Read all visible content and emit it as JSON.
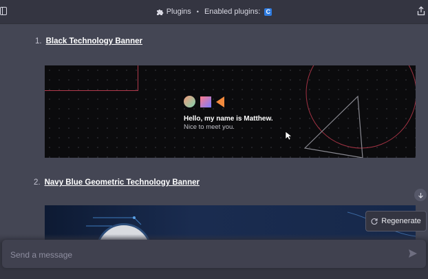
{
  "header": {
    "title": "Plugins",
    "separator": "•",
    "enabled_label": "Enabled plugins:",
    "plugin_badge": "C",
    "accent": "#2e7be0"
  },
  "items": [
    {
      "number": "1.",
      "title": "Black Technology Banner"
    },
    {
      "number": "2.",
      "title": "Navy Blue Geometric Technology Banner"
    }
  ],
  "banner1": {
    "hello": "Hello, my name is Matthew.",
    "nice": "Nice to meet you."
  },
  "regenerate_label": "Regenerate",
  "composer": {
    "placeholder": "Send a message"
  },
  "colors": {
    "background": "#444654",
    "header_bg": "#343541",
    "composer_bg": "#40414f",
    "banner_accent": "#b33a4d"
  }
}
